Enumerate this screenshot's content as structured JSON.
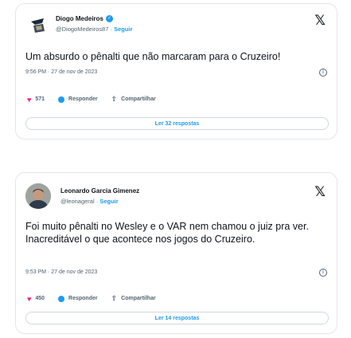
{
  "tweets": [
    {
      "name": "Diogo Medeiros",
      "handle": "@DiogoMedeiros87",
      "follow": "Seguir",
      "text": "Um absurdo o pênalti que não marcaram para o Cruzeiro!",
      "timestamp": "9:56 PM · 27 de nov de 2023",
      "likes": "571",
      "reply_label": "Responder",
      "share_label": "Compartilhar",
      "replies_button": "Ler 32 respostas"
    },
    {
      "name": "Leonardo Garcia Gimenez",
      "handle": "@leonageral",
      "follow": "Seguir",
      "text": "Foi muito pênalti no Wesley e o VAR nem chamou o juiz pra ver. Inacreditável o que acontece nos jogos do Cruzeiro.",
      "timestamp": "9:53 PM · 27 de nov de 2023",
      "likes": "450",
      "reply_label": "Responder",
      "share_label": "Compartilhar",
      "replies_button": "Ler 14 respostas"
    }
  ],
  "icons": {
    "verified": "verified-badge-icon",
    "x_logo": "x-logo-icon",
    "info": "info-icon",
    "like": "heart-icon",
    "reply": "reply-bubble-icon",
    "share": "share-icon"
  },
  "colors": {
    "accent": "#1d9bf0",
    "like": "#f91880",
    "text": "#0f1419",
    "muted": "#536471",
    "border": "#e3e7ea"
  }
}
